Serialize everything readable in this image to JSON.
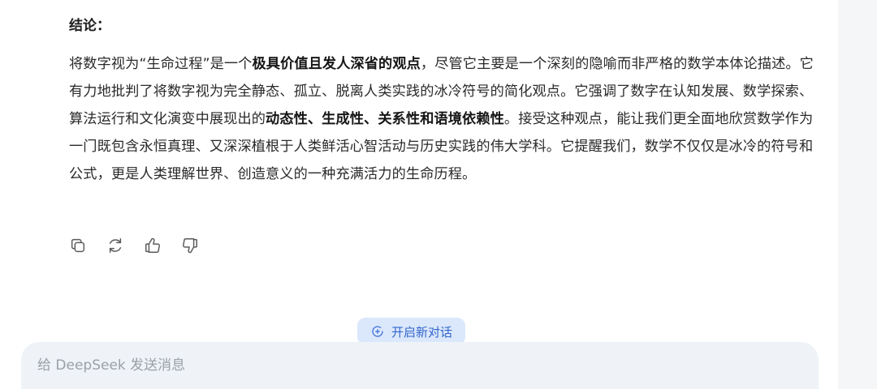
{
  "conclusion": {
    "heading": "结论：",
    "segments": [
      {
        "text": "将数字视为“生命过程”是一个",
        "bold": false
      },
      {
        "text": "极具价值且发人深省的观点",
        "bold": true
      },
      {
        "text": "，尽管它主要是一个深刻的隐喻而非严格的数学本体论描述。它有力地批判了将数字视为完全静态、孤立、脱离人类实践的冰冷符号的简化观点。它强调了数字在认知发展、数学探索、算法运行和文化演变中展现出的",
        "bold": false
      },
      {
        "text": "动态性、生成性、关系性和语境依赖性",
        "bold": true
      },
      {
        "text": "。接受这种观点，能让我们更全面地欣赏数学作为一门既包含永恒真理、又深深植根于人类鲜活心智活动与历史实践的伟大学科。它提醒我们，数学不仅仅是冰冷的符号和公式，更是人类理解世界、创造意义的一种充满活力的生命历程。",
        "bold": false
      }
    ]
  },
  "actions": {
    "copy_icon": "copy-icon",
    "regenerate_icon": "refresh-icon",
    "like_icon": "thumbs-up-icon",
    "dislike_icon": "thumbs-down-icon"
  },
  "new_chat": {
    "label": "开启新对话",
    "icon": "new-chat-icon"
  },
  "input": {
    "placeholder": "给 DeepSeek 发送消息",
    "value": ""
  },
  "colors": {
    "accent": "#3466cc",
    "new_chat_bg": "#dbe8fb",
    "input_bg": "#eff3f8"
  }
}
